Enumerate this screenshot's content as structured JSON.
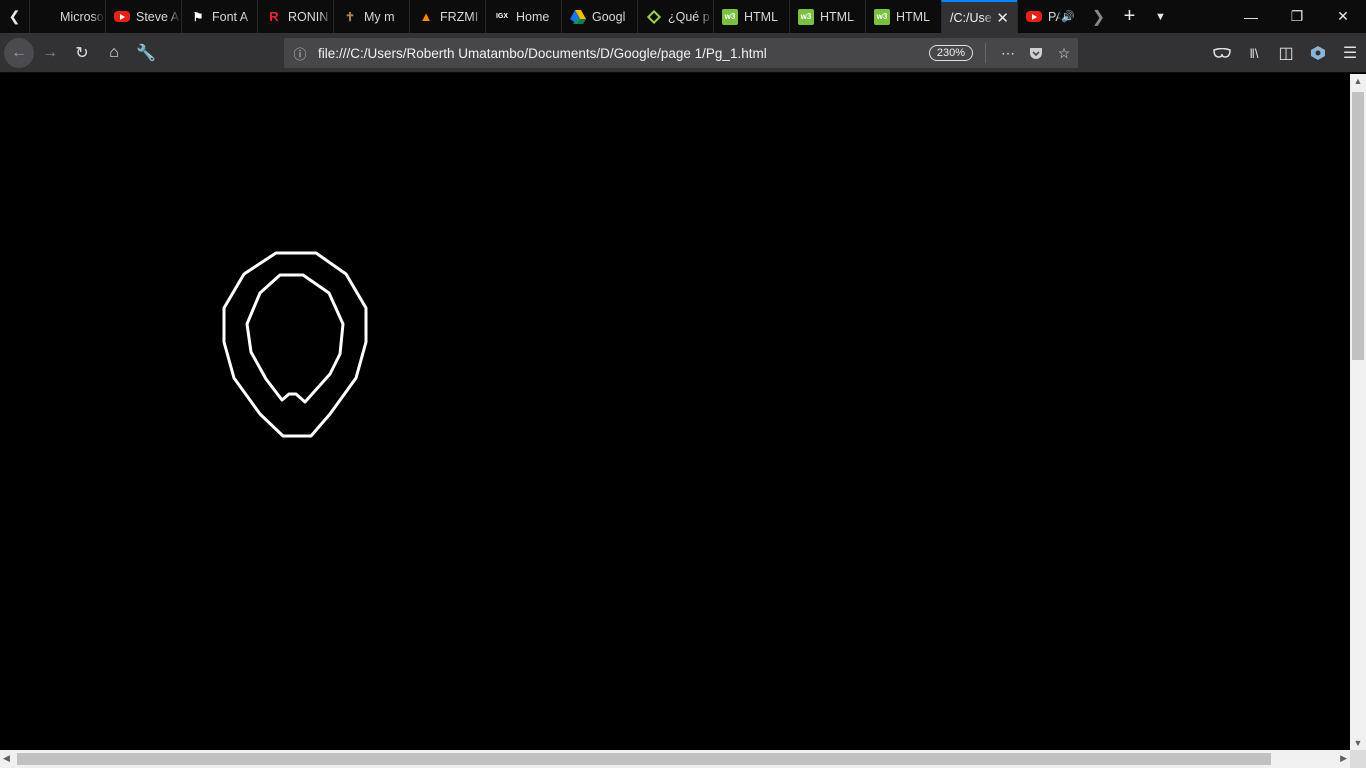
{
  "browser": {
    "tabs": [
      {
        "title": "Microsoft",
        "favicon": "microsoft-icon"
      },
      {
        "title": "Steve A",
        "favicon": "youtube-icon"
      },
      {
        "title": "Font A",
        "favicon": "flag-icon"
      },
      {
        "title": "RONIN",
        "favicon": "ronin-icon"
      },
      {
        "title": "My m",
        "favicon": "figure-icon"
      },
      {
        "title": "FRZMI",
        "favicon": "fire-icon"
      },
      {
        "title": "Home",
        "favicon": "igx-icon",
        "favicon_text": "IGX"
      },
      {
        "title": "Googl",
        "favicon": "google-drive-icon"
      },
      {
        "title": "¿Qué p",
        "favicon": "diamond-icon"
      },
      {
        "title": "HTML",
        "favicon": "w3schools-icon",
        "favicon_text": "w3"
      },
      {
        "title": "HTML",
        "favicon": "w3schools-icon",
        "favicon_text": "w3"
      },
      {
        "title": "HTML",
        "favicon": "w3schools-icon",
        "favicon_text": "w3"
      },
      {
        "title": "/C:/Use",
        "favicon": "none",
        "active": true
      },
      {
        "title": "PA",
        "favicon": "youtube-icon",
        "audio": true
      }
    ],
    "url": "file:///C:/Users/Roberth Umatambo/Documents/D/Google/page 1/Pg_1.html",
    "zoom": "230%",
    "accent_color": "#0a84ff"
  }
}
